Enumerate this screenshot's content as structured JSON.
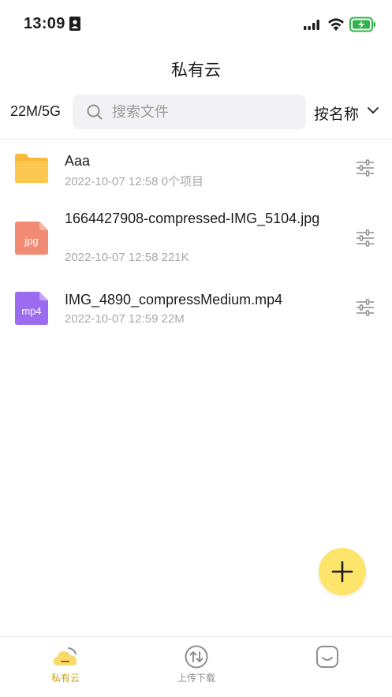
{
  "status_bar": {
    "time": "13:09",
    "icons": [
      "contact-card-icon",
      "signal-icon",
      "wifi-icon",
      "battery-charging-icon"
    ]
  },
  "header": {
    "title": "私有云"
  },
  "toolbar": {
    "storage_usage": "22M/5G",
    "search_placeholder": "搜索文件",
    "sort_label": "按名称"
  },
  "files": [
    {
      "name": "Aaa",
      "date": "2022-10-07 12:58",
      "info": "0个项目",
      "icon": "folder-icon",
      "icon_label": ""
    },
    {
      "name": "1664427908-compressed-IMG_5104.jpg",
      "date": "2022-10-07 12:58",
      "info": "221K",
      "icon": "jpg-file-icon",
      "icon_label": "jpg"
    },
    {
      "name": "IMG_4890_compressMedium.mp4",
      "date": "2022-10-07 12:59",
      "info": "22M",
      "icon": "mp4-file-icon",
      "icon_label": "mp4"
    }
  ],
  "tabs": [
    {
      "label": "私有云",
      "active": true
    },
    {
      "label": "上传下载",
      "active": false
    },
    {
      "label": "",
      "active": false
    }
  ],
  "colors": {
    "accent": "#fde56b",
    "folder": "#fcc84f",
    "jpg": "#f28b74",
    "mp4": "#9b6cf0",
    "active_tab": "#c9a31b"
  }
}
